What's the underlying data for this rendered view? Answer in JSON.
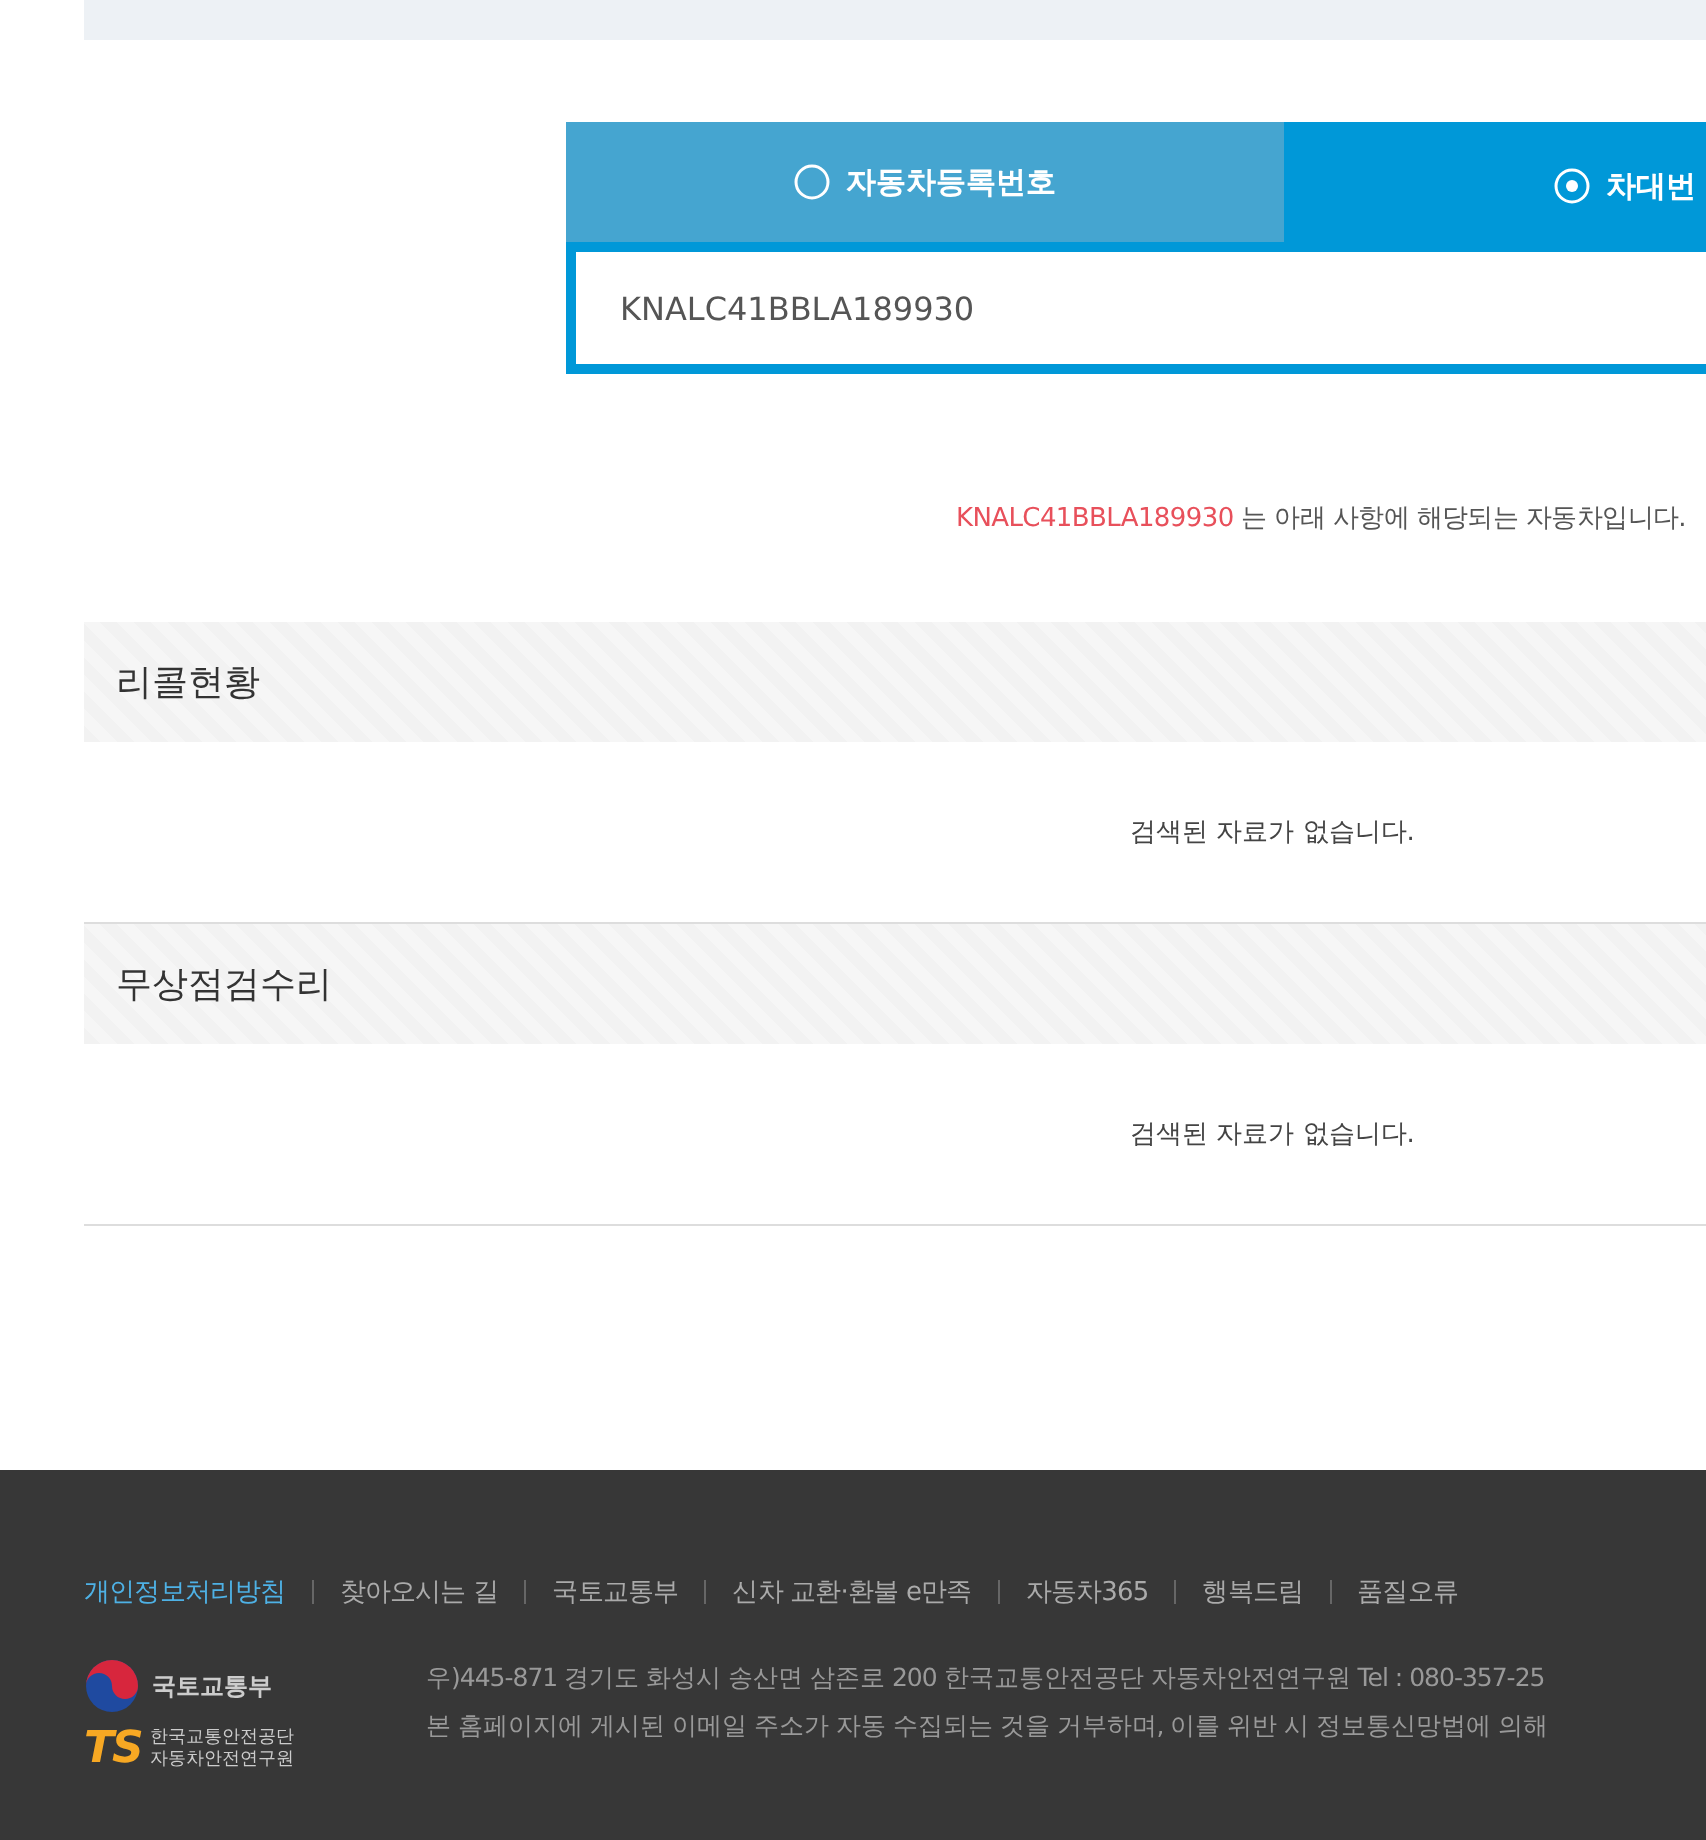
{
  "tabs": [
    {
      "label": "자동차등록번호",
      "selected": false
    },
    {
      "label": "차대번",
      "selected": true
    }
  ],
  "search": {
    "value": "KNALC41BBLA189930"
  },
  "result_notice": {
    "vin": "KNALC41BBLA189930",
    "text": "는 아래 사항에 해당되는 자동차입니다."
  },
  "sections": [
    {
      "title": "리콜현황",
      "empty_message": "검색된 자료가 없습니다."
    },
    {
      "title": "무상점검수리",
      "empty_message": "검색된 자료가 없습니다."
    }
  ],
  "footer": {
    "links": [
      {
        "label": "개인정보처리방침",
        "highlighted": true
      },
      {
        "label": "찾아오시는 길",
        "highlighted": false
      },
      {
        "label": "국토교통부",
        "highlighted": false
      },
      {
        "label": "신차 교환·환불 e만족",
        "highlighted": false
      },
      {
        "label": "자동차365",
        "highlighted": false
      },
      {
        "label": "행복드림",
        "highlighted": false
      },
      {
        "label": "품질오류",
        "highlighted": false
      }
    ],
    "ministry_logo": "국토교통부",
    "ts_logo": {
      "mark": "TS",
      "lines": [
        "한국교통안전공단",
        "자동차안전연구원"
      ]
    },
    "address_lines": [
      "우)445-871 경기도 화성시 송산면 삼존로 200 한국교통안전공단 자동차안전연구원 Tel : 080-357-25",
      "본 홈페이지에 게시된 이메일 주소가 자동 수집되는 것을 거부하며, 이를 위반 시 정보통신망법에 의해"
    ]
  }
}
